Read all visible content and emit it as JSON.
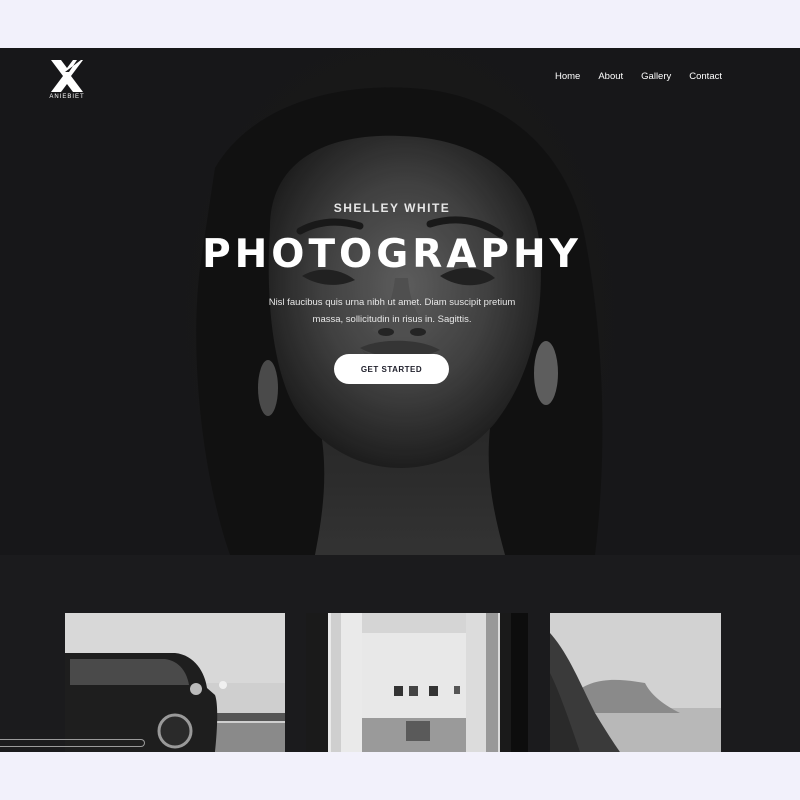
{
  "brand": {
    "logo_text": "ANIEBIET"
  },
  "nav": {
    "items": [
      {
        "label": "Home"
      },
      {
        "label": "About"
      },
      {
        "label": "Gallery"
      },
      {
        "label": "Contact"
      }
    ]
  },
  "hero": {
    "subtitle": "SHELLEY WHITE",
    "title": "PHOTOGRAPHY",
    "description": "Nisl faucibus quis urna nibh ut amet. Diam suscipit pretium massa, sollicitudin in risus in. Sagittis.",
    "cta_label": "GET STARTED"
  },
  "gallery": {
    "items": [
      {
        "subject": "car"
      },
      {
        "subject": "gallery-interior"
      },
      {
        "subject": "coastal-cliff"
      }
    ]
  },
  "colors": {
    "page_background": "#f2f1fb",
    "site_background": "#1b1b1d",
    "text": "#ffffff",
    "button": "#ffffff"
  }
}
